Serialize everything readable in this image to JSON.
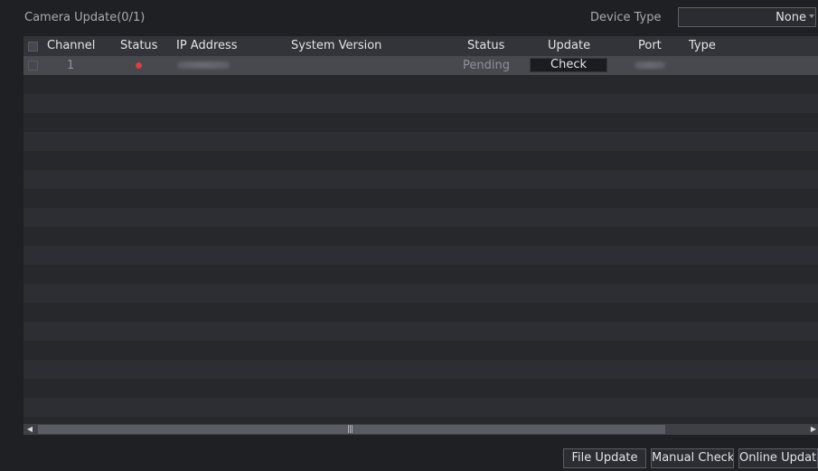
{
  "header": {
    "title": "Camera Update(0/1)",
    "device_type_label": "Device Type",
    "device_type_value": "None"
  },
  "table": {
    "columns": {
      "channel": "Channel",
      "status": "Status",
      "ip": "IP Address",
      "system_version": "System Version",
      "update_status": "Status",
      "update": "Update",
      "port": "Port",
      "type": "Type"
    },
    "rows": [
      {
        "channel": "1",
        "status_color": "#e23b3b",
        "update_status": "Pending",
        "update_button": "Check"
      }
    ]
  },
  "buttons": {
    "file_update": "File Update",
    "manual_check": "Manual Check",
    "online_update": "Online Update"
  },
  "colors": {
    "background": "#1f2024",
    "status_offline": "#e23b3b"
  }
}
